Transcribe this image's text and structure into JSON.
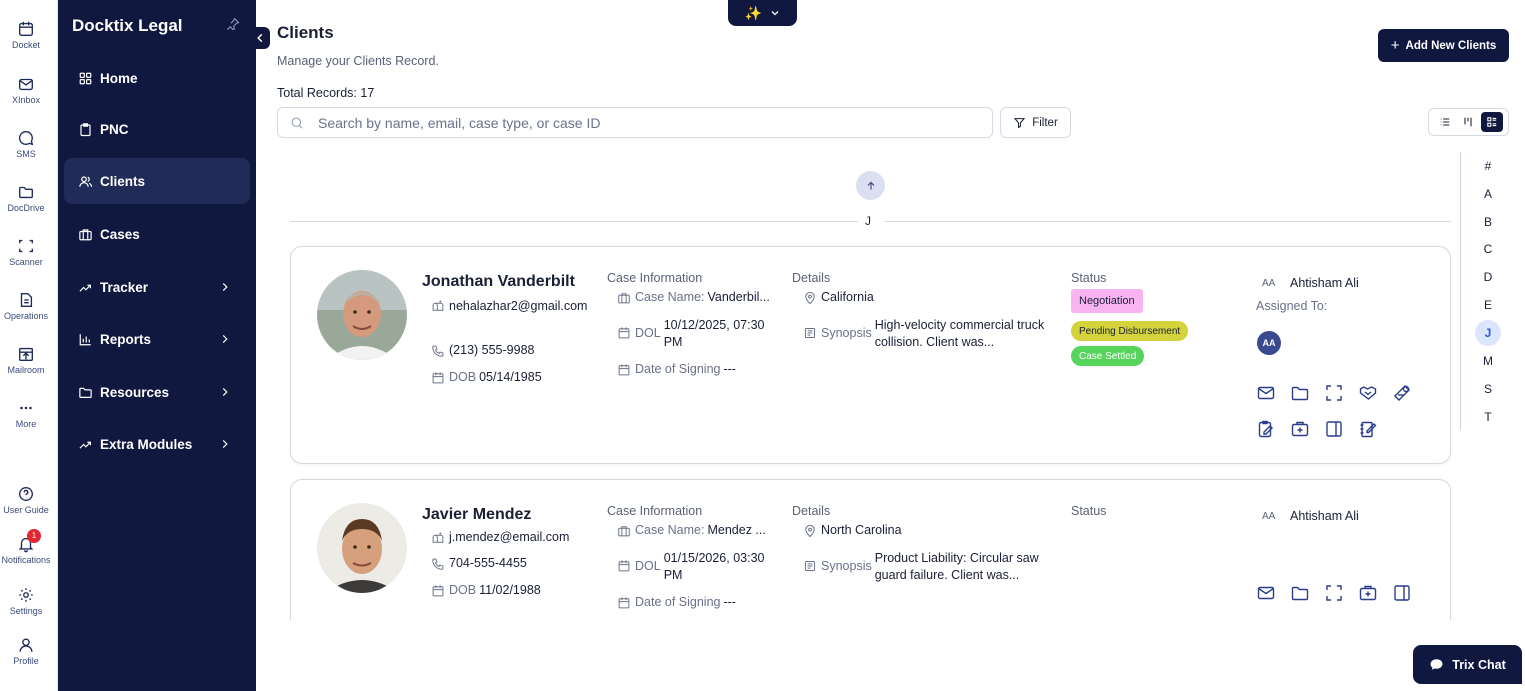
{
  "rail": {
    "items": [
      {
        "label": "Docket",
        "icon": "calendar-icon"
      },
      {
        "label": "XInbox",
        "icon": "mail-icon"
      },
      {
        "label": "SMS",
        "icon": "chat-bubble-icon"
      },
      {
        "label": "DocDrive",
        "icon": "folder-icon"
      },
      {
        "label": "Scanner",
        "icon": "scan-icon"
      },
      {
        "label": "Operations",
        "icon": "document-icon"
      },
      {
        "label": "Mailroom",
        "icon": "mailroom-icon"
      },
      {
        "label": "More",
        "icon": "more-dots-icon"
      },
      {
        "label": "User Guide",
        "icon": "help-icon"
      },
      {
        "label": "Notifications",
        "icon": "bell-icon",
        "badge": "1"
      },
      {
        "label": "Settings",
        "icon": "gear-icon"
      },
      {
        "label": "Profile",
        "icon": "user-icon"
      }
    ]
  },
  "sidebar": {
    "brand": "Docktix Legal",
    "items": [
      {
        "label": "Home",
        "icon": "grid-icon"
      },
      {
        "label": "PNC",
        "icon": "clipboard-icon"
      },
      {
        "label": "Clients",
        "icon": "users-icon",
        "active": true
      },
      {
        "label": "Cases",
        "icon": "briefcase-icon"
      },
      {
        "label": "Tracker",
        "icon": "trend-icon",
        "has_children": true
      },
      {
        "label": "Reports",
        "icon": "bar-chart-icon",
        "has_children": true
      },
      {
        "label": "Resources",
        "icon": "folder-icon",
        "has_children": true
      },
      {
        "label": "Extra Modules",
        "icon": "trend-icon",
        "has_children": true
      }
    ]
  },
  "ai_pill": {
    "icon": "sparkles-icon"
  },
  "page": {
    "title": "Clients",
    "subtitle": "Manage your Clients Record.",
    "total_records": "Total Records: 17",
    "add_button": "Add New Clients",
    "search_placeholder": "Search by name, email, case type, or case ID",
    "filter_label": "Filter",
    "section_letter": "J"
  },
  "alphabet": [
    "#",
    "A",
    "B",
    "C",
    "D",
    "E",
    "J",
    "M",
    "S",
    "T"
  ],
  "alphabet_active": "J",
  "labels": {
    "case_information": "Case Information",
    "details": "Details",
    "status": "Status",
    "case_name": "Case Name:",
    "dol": "DOL",
    "date_of_signing": "Date of Signing",
    "synopsis": "Synopsis",
    "dob": "DOB",
    "assigned_to": "Assigned To:",
    "aa": "AA"
  },
  "clients": [
    {
      "name": "Jonathan Vanderbilt",
      "email": "nehalazhar2@gmail.com",
      "phone": "(213) 555-9988",
      "dob": "05/14/1985",
      "case_name": "Vanderbil...",
      "dol": "10/12/2025, 07:30 PM",
      "date_of_signing": "---",
      "location": "California",
      "synopsis": "High-velocity commercial truck collision. Client was...",
      "statuses": [
        "Negotiation",
        "Pending Disbursement",
        "Case Settled"
      ],
      "assignee": "Ahtisham Ali",
      "assigned_initials": "AA"
    },
    {
      "name": "Javier Mendez",
      "email": "j.mendez@email.com",
      "phone": "704-555-4455",
      "dob": "11/02/1988",
      "case_name": "Mendez ...",
      "dol": "01/15/2026, 03:30 PM",
      "date_of_signing": "---",
      "location": "North Carolina",
      "synopsis": "Product Liability: Circular saw guard failure. Client was...",
      "statuses": [],
      "assignee": "Ahtisham Ali"
    }
  ],
  "chat": {
    "label": "Trix Chat"
  },
  "colors": {
    "navy": "#10183f",
    "accent": "#2b3c8c",
    "negotiation": "#f8b4f0",
    "pending": "#d4d33c",
    "settled": "#57d45c"
  }
}
